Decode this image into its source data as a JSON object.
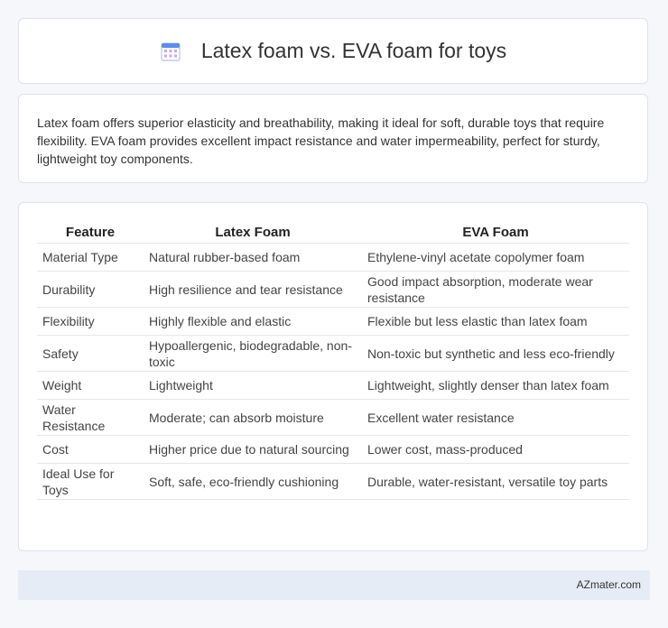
{
  "header": {
    "title": "Latex foam vs. EVA foam for toys",
    "icon": "calendar-icon"
  },
  "intro": {
    "text": "Latex foam offers superior elasticity and breathability, making it ideal for soft, durable toys that require flexibility. EVA foam provides excellent impact resistance and water impermeability, perfect for sturdy, lightweight toy components."
  },
  "table": {
    "headers": [
      "Feature",
      "Latex Foam",
      "EVA Foam"
    ],
    "rows": [
      [
        "Material Type",
        "Natural rubber-based foam",
        "Ethylene-vinyl acetate copolymer foam"
      ],
      [
        "Durability",
        "High resilience and tear resistance",
        "Good impact absorption, moderate wear resistance"
      ],
      [
        "Flexibility",
        "Highly flexible and elastic",
        "Flexible but less elastic than latex foam"
      ],
      [
        "Safety",
        "Hypoallergenic, biodegradable, non-toxic",
        "Non-toxic but synthetic and less eco-friendly"
      ],
      [
        "Weight",
        "Lightweight",
        "Lightweight, slightly denser than latex foam"
      ],
      [
        "Water Resistance",
        "Moderate; can absorb moisture",
        "Excellent water resistance"
      ],
      [
        "Cost",
        "Higher price due to natural sourcing",
        "Lower cost, mass-produced"
      ],
      [
        "Ideal Use for Toys",
        "Soft, safe, eco-friendly cushioning",
        "Durable, water-resistant, versatile toy parts"
      ]
    ]
  },
  "footer": {
    "text": "AZmater.com"
  }
}
